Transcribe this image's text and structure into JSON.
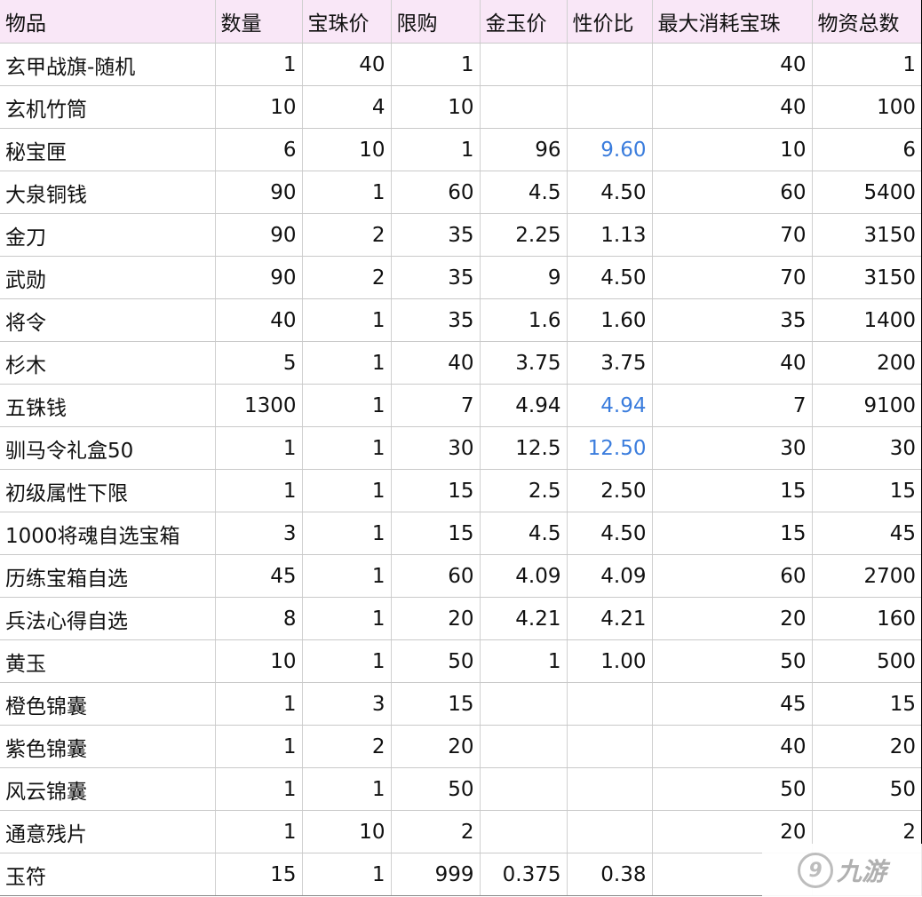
{
  "table": {
    "headers": [
      "物品",
      "数量",
      "宝珠价",
      "限购",
      "金玉价",
      "性价比",
      "最大消耗宝珠",
      "物资总数"
    ],
    "rows": [
      {
        "cells": [
          "玄甲战旗-随机",
          "1",
          "40",
          "1",
          "",
          "",
          "40",
          "1"
        ]
      },
      {
        "cells": [
          "玄机竹筒",
          "10",
          "4",
          "10",
          "",
          "",
          "40",
          "100"
        ]
      },
      {
        "cells": [
          "秘宝匣",
          "6",
          "10",
          "1",
          "96",
          "9.60",
          "10",
          "6"
        ],
        "highlight": true
      },
      {
        "cells": [
          "大泉铜钱",
          "90",
          "1",
          "60",
          "4.5",
          "4.50",
          "60",
          "5400"
        ]
      },
      {
        "cells": [
          "金刀",
          "90",
          "2",
          "35",
          "2.25",
          "1.13",
          "70",
          "3150"
        ]
      },
      {
        "cells": [
          "武勋",
          "90",
          "2",
          "35",
          "9",
          "4.50",
          "70",
          "3150"
        ]
      },
      {
        "cells": [
          "将令",
          "40",
          "1",
          "35",
          "1.6",
          "1.60",
          "35",
          "1400"
        ]
      },
      {
        "cells": [
          "杉木",
          "5",
          "1",
          "40",
          "3.75",
          "3.75",
          "40",
          "200"
        ]
      },
      {
        "cells": [
          "五铢钱",
          "1300",
          "1",
          "7",
          "4.94",
          "4.94",
          "7",
          "9100"
        ],
        "highlight": true
      },
      {
        "cells": [
          "驯马令礼盒50",
          "1",
          "1",
          "30",
          "12.5",
          "12.50",
          "30",
          "30"
        ],
        "highlight": true
      },
      {
        "cells": [
          "初级属性下限",
          "1",
          "1",
          "15",
          "2.5",
          "2.50",
          "15",
          "15"
        ]
      },
      {
        "cells": [
          "1000将魂自选宝箱",
          "3",
          "1",
          "15",
          "4.5",
          "4.50",
          "15",
          "45"
        ]
      },
      {
        "cells": [
          "历练宝箱自选",
          "45",
          "1",
          "60",
          "4.09",
          "4.09",
          "60",
          "2700"
        ]
      },
      {
        "cells": [
          "兵法心得自选",
          "8",
          "1",
          "20",
          "4.21",
          "4.21",
          "20",
          "160"
        ]
      },
      {
        "cells": [
          "黄玉",
          "10",
          "1",
          "50",
          "1",
          "1.00",
          "50",
          "500"
        ]
      },
      {
        "cells": [
          "橙色锦囊",
          "1",
          "3",
          "15",
          "",
          "",
          "45",
          "15"
        ]
      },
      {
        "cells": [
          "紫色锦囊",
          "1",
          "2",
          "20",
          "",
          "",
          "40",
          "20"
        ]
      },
      {
        "cells": [
          "风云锦囊",
          "1",
          "1",
          "50",
          "",
          "",
          "50",
          "50"
        ]
      },
      {
        "cells": [
          "通意残片",
          "1",
          "10",
          "2",
          "",
          "",
          "20",
          "2"
        ]
      },
      {
        "cells": [
          "玉符",
          "15",
          "1",
          "999",
          "0.375",
          "0.38",
          "",
          ""
        ]
      }
    ]
  },
  "colors": {
    "header_bg": "#f9e7f7",
    "highlight_text": "#3b7ddd"
  },
  "watermark": {
    "text": "九游",
    "icon": "jiuyou-logo-icon"
  }
}
